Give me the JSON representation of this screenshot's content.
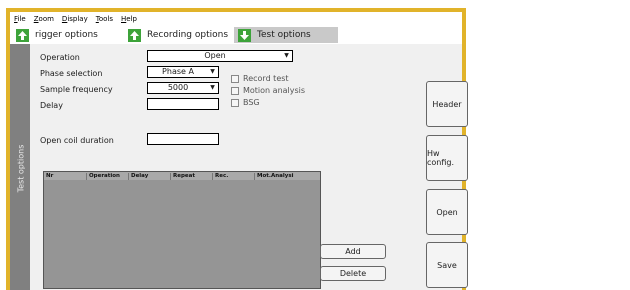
{
  "menubar": {
    "items": [
      {
        "hot": "F",
        "rest": "ile"
      },
      {
        "hot": "Z",
        "rest": "oom"
      },
      {
        "hot": "D",
        "rest": "isplay"
      },
      {
        "hot": "T",
        "rest": "ools"
      },
      {
        "hot": "H",
        "rest": "elp"
      }
    ]
  },
  "tabs": [
    {
      "label": "rigger options",
      "direction": "up"
    },
    {
      "label": "Recording options",
      "direction": "up"
    },
    {
      "label": "Test options",
      "direction": "down",
      "active": true
    }
  ],
  "side_tab": {
    "label": "Test options"
  },
  "form": {
    "operation": {
      "label": "Operation",
      "value": "Open"
    },
    "phase_selection": {
      "label": "Phase selection",
      "value": "Phase A"
    },
    "sample_frequency": {
      "label": "Sample frequency",
      "value": "5000"
    },
    "delay": {
      "label": "Delay",
      "value": ""
    },
    "open_coil_duration": {
      "label": "Open coil duration",
      "value": ""
    }
  },
  "checkboxes": {
    "record_test": {
      "label": "Record test",
      "checked": false
    },
    "motion_analysis": {
      "label": "Motion analysis",
      "checked": false
    },
    "bsg": {
      "label": "BSG",
      "checked": false
    }
  },
  "table": {
    "columns": [
      "Nr",
      "Operation",
      "Delay",
      "Repeat",
      "Rec.",
      "Mot.Analysi"
    ],
    "rows": []
  },
  "buttons": {
    "add": "Add",
    "delete": "Delete"
  },
  "right_buttons": {
    "header": "Header",
    "hw_config": "Hw config.",
    "open": "Open",
    "save": "Save"
  },
  "colors": {
    "frame": "#e1b32a",
    "tab_arrow": "#3da33a",
    "table_bg": "#959595",
    "side_tab": "#808080"
  }
}
